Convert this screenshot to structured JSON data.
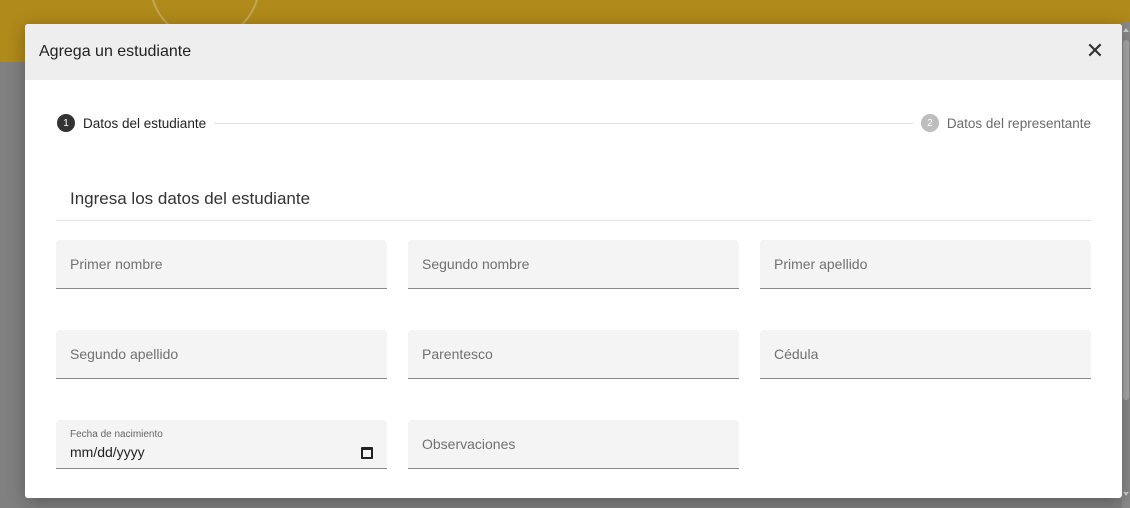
{
  "dialog": {
    "title": "Agrega un estudiante",
    "close_icon": "close-icon"
  },
  "stepper": {
    "steps": [
      {
        "number": "1",
        "label": "Datos del estudiante",
        "state": "active"
      },
      {
        "number": "2",
        "label": "Datos del representante",
        "state": "inactive"
      }
    ]
  },
  "form": {
    "section_title": "Ingresa los datos del estudiante",
    "fields": {
      "primer_nombre": {
        "placeholder": "Primer nombre",
        "value": ""
      },
      "segundo_nombre": {
        "placeholder": "Segundo nombre",
        "value": ""
      },
      "primer_apellido": {
        "placeholder": "Primer apellido",
        "value": ""
      },
      "segundo_apellido": {
        "placeholder": "Segundo apellido",
        "value": ""
      },
      "parentesco": {
        "placeholder": "Parentesco",
        "value": ""
      },
      "cedula": {
        "placeholder": "Cédula",
        "value": ""
      },
      "fecha_nacimiento": {
        "label": "Fecha de nacimiento",
        "value": "mm/dd/yyyy",
        "icon": "calendar-icon"
      },
      "observaciones": {
        "placeholder": "Observaciones",
        "value": ""
      }
    }
  },
  "colors": {
    "header_bar": "#b08a1a",
    "active_step": "#333333",
    "inactive_step": "#bdbdbd",
    "field_bg": "#f4f4f4"
  }
}
